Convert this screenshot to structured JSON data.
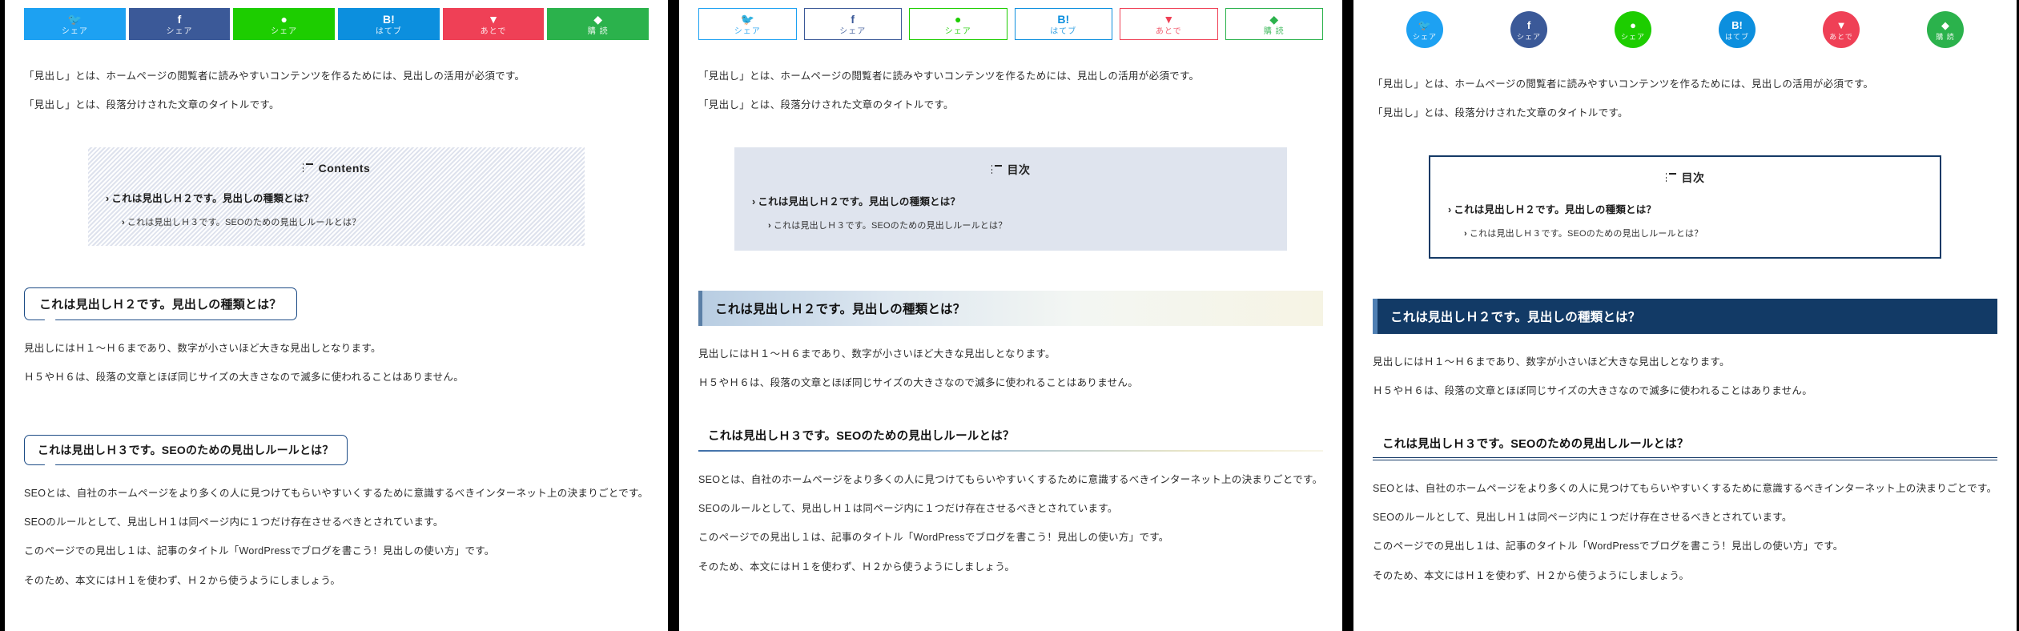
{
  "background_color": "#000000",
  "share_buttons": [
    {
      "network": "twitter",
      "icon": "twitter-bird-icon",
      "glyph": "🐦",
      "label": "シェア",
      "color": "#1da1f2"
    },
    {
      "network": "facebook",
      "icon": "facebook-f-icon",
      "glyph": "f",
      "label": "シェア",
      "color": "#3b5998"
    },
    {
      "network": "line",
      "icon": "line-balloon-icon",
      "glyph": "●",
      "label": "シェア",
      "color": "#1dcd00"
    },
    {
      "network": "hatena",
      "icon": "hatena-bookmark-icon",
      "glyph": "B!",
      "label": "はてブ",
      "color": "#0c8fde"
    },
    {
      "network": "pocket",
      "icon": "pocket-icon",
      "glyph": "▼",
      "label": "あとで",
      "color": "#ef4056"
    },
    {
      "network": "feedly",
      "icon": "feedly-icon",
      "glyph": "◆",
      "label": "購 読",
      "color": "#2bb24c"
    }
  ],
  "article": {
    "lede": [
      "「見出し」とは、ホームページの閲覧者に読みやすいコンテンツを作るためには、見出しの活用が必須です。",
      "「見出し」とは、段落分けされた文章のタイトルです。"
    ],
    "h2_text": "これは見出しＨ２です。見出しの種類とは？",
    "h2_body": [
      "見出しにはＨ１〜Ｈ６まであり、数字が小さいほど大きな見出しとなります。",
      "Ｈ５やＨ６は、段落の文章とほぼ同じサイズの大きさなので滅多に使われることはありません。"
    ],
    "h3_text": "これは見出しＨ３です。SEOのための見出しルールとは？",
    "h3_body": [
      "SEOとは、自社のホームページをより多くの人に見つけてもらいやすいくするために意識するべきインターネット上の決まりごとです。",
      "SEOのルールとして、見出しＨ１は同ページ内に１つだけ存在させるべきとされています。",
      "このページでの見出し１は、記事のタイトル「WordPressでブログを書こう！見出しの使い方」です。",
      "そのため、本文にはＨ１を使わず、Ｈ２から使うようにしましょう。"
    ]
  },
  "panels": [
    {
      "id": "panel-1",
      "share_style": "block",
      "toc": {
        "title": "Contents",
        "style": "hatched",
        "items": [
          {
            "level": 1,
            "text": "これは見出しＨ２です。見出しの種類とは？"
          },
          {
            "level": 2,
            "text": "これは見出しＨ３です。SEOのための見出しルールとは？"
          }
        ]
      },
      "h2_style": "speech-bubble-outline",
      "h3_style": "speech-bubble-outline",
      "accent_color": "#1d4c86"
    },
    {
      "id": "panel-2",
      "share_style": "outline",
      "toc": {
        "title": "目次",
        "style": "flat-blue-gray",
        "items": [
          {
            "level": 1,
            "text": "これは見出しＨ２です。見出しの種類とは？"
          },
          {
            "level": 2,
            "text": "これは見出しＨ３です。SEOのための見出しルールとは？"
          }
        ]
      },
      "h2_style": "gradient-bar",
      "h3_style": "gradient-underline",
      "accent_color": "#5a7fa6"
    },
    {
      "id": "panel-3",
      "share_style": "circle",
      "toc": {
        "title": "目次",
        "style": "navy-border",
        "items": [
          {
            "level": 1,
            "text": "これは見出しＨ２です。見出しの種類とは？"
          },
          {
            "level": 2,
            "text": "これは見出しＨ３です。SEOのための見出しルールとは？"
          }
        ]
      },
      "h2_style": "solid-navy",
      "h3_style": "double-underline",
      "accent_color": "#123a66"
    }
  ],
  "chevron": "›"
}
